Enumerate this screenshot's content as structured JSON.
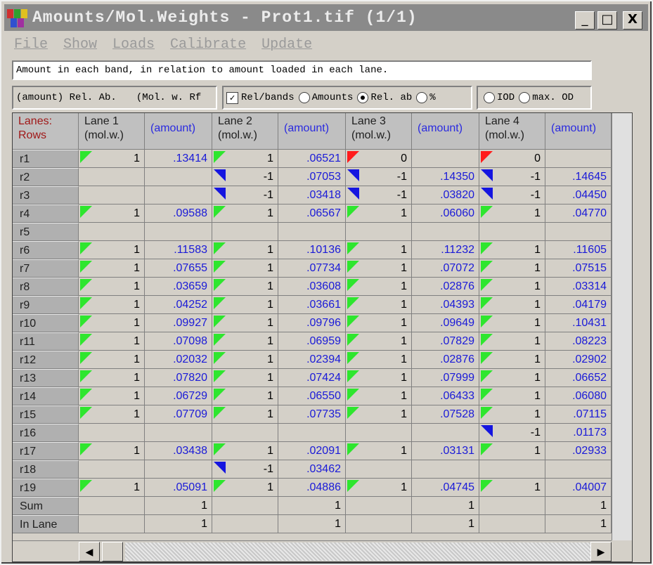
{
  "window": {
    "title": "Amounts/Mol.Weights - Prot1.tif (1/1)",
    "min_label": "_",
    "max_label": "□",
    "close_label": "X"
  },
  "menu": [
    "File",
    "Show",
    "Loads",
    "Calibrate",
    "Update"
  ],
  "info_text": "Amount in each band, in relation to amount loaded in each lane.",
  "panel1": {
    "left": "(amount) Rel. Ab.",
    "right": "(Mol. w.  Rf"
  },
  "panel2": {
    "checkbox_label": "Rel/bands",
    "opt1": "Amounts",
    "opt2": "Rel. ab",
    "opt3": "%"
  },
  "panel3": {
    "opt1": "IOD",
    "opt2": "max. OD"
  },
  "colors": {
    "green_flag": "#2ee62e",
    "blue_flag": "#1515e0",
    "red_flag": "#ff1c1c",
    "amount_text": "#1a1ad8",
    "corner_text": "#a01818"
  },
  "grid": {
    "corner_line1": "Lanes:",
    "corner_line2": "Rows",
    "lanes": [
      {
        "title": "Lane 1",
        "mw_header": "(mol.w.)",
        "amt_header": "(amount)"
      },
      {
        "title": "Lane 2",
        "mw_header": "(mol.w.)",
        "amt_header": "(amount)"
      },
      {
        "title": "Lane 3",
        "mw_header": "(mol.w.)",
        "amt_header": "(amount)"
      },
      {
        "title": "Lane 4",
        "mw_header": "(mol.w.)",
        "amt_header": "(amount)"
      }
    ],
    "rows": [
      {
        "label": "r1",
        "cells": [
          [
            "g",
            "1",
            ".13414"
          ],
          [
            "g",
            "1",
            ".06521"
          ],
          [
            "r",
            "0",
            ""
          ],
          [
            "r",
            "0",
            ""
          ]
        ]
      },
      {
        "label": "r2",
        "cells": [
          [
            "",
            "",
            ""
          ],
          [
            "b",
            "-1",
            ".07053"
          ],
          [
            "b",
            "-1",
            ".14350"
          ],
          [
            "b",
            "-1",
            ".14645"
          ]
        ]
      },
      {
        "label": "r3",
        "cells": [
          [
            "",
            "",
            ""
          ],
          [
            "b",
            "-1",
            ".03418"
          ],
          [
            "b",
            "-1",
            ".03820"
          ],
          [
            "b",
            "-1",
            ".04450"
          ]
        ]
      },
      {
        "label": "r4",
        "cells": [
          [
            "g",
            "1",
            ".09588"
          ],
          [
            "g",
            "1",
            ".06567"
          ],
          [
            "g",
            "1",
            ".06060"
          ],
          [
            "g",
            "1",
            ".04770"
          ]
        ]
      },
      {
        "label": "r5",
        "cells": [
          [
            "",
            "",
            ""
          ],
          [
            "",
            "",
            ""
          ],
          [
            "",
            "",
            ""
          ],
          [
            "",
            "",
            ""
          ]
        ]
      },
      {
        "label": "r6",
        "cells": [
          [
            "g",
            "1",
            ".11583"
          ],
          [
            "g",
            "1",
            ".10136"
          ],
          [
            "g",
            "1",
            ".11232"
          ],
          [
            "g",
            "1",
            ".11605"
          ]
        ]
      },
      {
        "label": "r7",
        "cells": [
          [
            "g",
            "1",
            ".07655"
          ],
          [
            "g",
            "1",
            ".07734"
          ],
          [
            "g",
            "1",
            ".07072"
          ],
          [
            "g",
            "1",
            ".07515"
          ]
        ]
      },
      {
        "label": "r8",
        "cells": [
          [
            "g",
            "1",
            ".03659"
          ],
          [
            "g",
            "1",
            ".03608"
          ],
          [
            "g",
            "1",
            ".02876"
          ],
          [
            "g",
            "1",
            ".03314"
          ]
        ]
      },
      {
        "label": "r9",
        "cells": [
          [
            "g",
            "1",
            ".04252"
          ],
          [
            "g",
            "1",
            ".03661"
          ],
          [
            "g",
            "1",
            ".04393"
          ],
          [
            "g",
            "1",
            ".04179"
          ]
        ]
      },
      {
        "label": "r10",
        "cells": [
          [
            "g",
            "1",
            ".09927"
          ],
          [
            "g",
            "1",
            ".09796"
          ],
          [
            "g",
            "1",
            ".09649"
          ],
          [
            "g",
            "1",
            ".10431"
          ]
        ]
      },
      {
        "label": "r11",
        "cells": [
          [
            "g",
            "1",
            ".07098"
          ],
          [
            "g",
            "1",
            ".06959"
          ],
          [
            "g",
            "1",
            ".07829"
          ],
          [
            "g",
            "1",
            ".08223"
          ]
        ]
      },
      {
        "label": "r12",
        "cells": [
          [
            "g",
            "1",
            ".02032"
          ],
          [
            "g",
            "1",
            ".02394"
          ],
          [
            "g",
            "1",
            ".02876"
          ],
          [
            "g",
            "1",
            ".02902"
          ]
        ]
      },
      {
        "label": "r13",
        "cells": [
          [
            "g",
            "1",
            ".07820"
          ],
          [
            "g",
            "1",
            ".07424"
          ],
          [
            "g",
            "1",
            ".07999"
          ],
          [
            "g",
            "1",
            ".06652"
          ]
        ]
      },
      {
        "label": "r14",
        "cells": [
          [
            "g",
            "1",
            ".06729"
          ],
          [
            "g",
            "1",
            ".06550"
          ],
          [
            "g",
            "1",
            ".06433"
          ],
          [
            "g",
            "1",
            ".06080"
          ]
        ]
      },
      {
        "label": "r15",
        "cells": [
          [
            "g",
            "1",
            ".07709"
          ],
          [
            "g",
            "1",
            ".07735"
          ],
          [
            "g",
            "1",
            ".07528"
          ],
          [
            "g",
            "1",
            ".07115"
          ]
        ]
      },
      {
        "label": "r16",
        "cells": [
          [
            "",
            "",
            ""
          ],
          [
            "",
            "",
            ""
          ],
          [
            "",
            "",
            ""
          ],
          [
            "b",
            "-1",
            ".01173"
          ]
        ]
      },
      {
        "label": "r17",
        "cells": [
          [
            "g",
            "1",
            ".03438"
          ],
          [
            "g",
            "1",
            ".02091"
          ],
          [
            "g",
            "1",
            ".03131"
          ],
          [
            "g",
            "1",
            ".02933"
          ]
        ]
      },
      {
        "label": "r18",
        "cells": [
          [
            "",
            "",
            ""
          ],
          [
            "b",
            "-1",
            ".03462"
          ],
          [
            "",
            "",
            ""
          ],
          [
            "",
            "",
            ""
          ]
        ]
      },
      {
        "label": "r19",
        "cells": [
          [
            "g",
            "1",
            ".05091"
          ],
          [
            "g",
            "1",
            ".04886"
          ],
          [
            "g",
            "1",
            ".04745"
          ],
          [
            "g",
            "1",
            ".04007"
          ]
        ]
      },
      {
        "label": "Sum",
        "cells": [
          [
            "",
            "",
            "1"
          ],
          [
            "",
            "",
            "1"
          ],
          [
            "",
            "",
            "1"
          ],
          [
            "",
            "",
            "1"
          ]
        ]
      },
      {
        "label": "In Lane",
        "cells": [
          [
            "",
            "",
            "1"
          ],
          [
            "",
            "",
            "1"
          ],
          [
            "",
            "",
            "1"
          ],
          [
            "",
            "",
            "1"
          ]
        ]
      }
    ]
  },
  "scroll": {
    "left_arrow": "◀",
    "right_arrow": "▶"
  }
}
